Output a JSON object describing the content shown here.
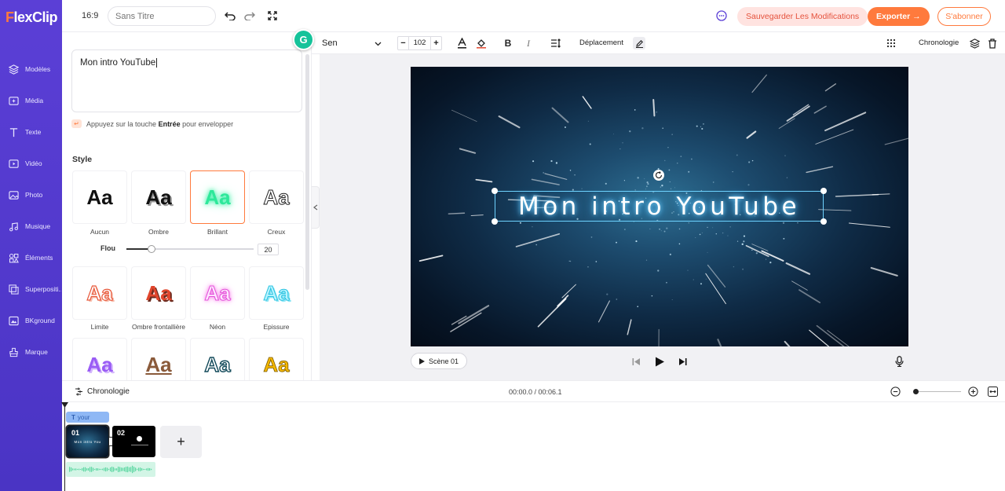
{
  "app": {
    "logo_f": "F",
    "logo_rest": "lexClip"
  },
  "sidebar": {
    "items": [
      {
        "label": "Modèles",
        "icon": "layers-icon"
      },
      {
        "label": "Média",
        "icon": "media-icon"
      },
      {
        "label": "Texte",
        "icon": "text-icon"
      },
      {
        "label": "Vidéo",
        "icon": "video-icon"
      },
      {
        "label": "Photo",
        "icon": "photo-icon"
      },
      {
        "label": "Musique",
        "icon": "music-icon"
      },
      {
        "label": "Éléments",
        "icon": "elements-icon"
      },
      {
        "label": "Superpositi...",
        "icon": "overlay-icon"
      },
      {
        "label": "BKground",
        "icon": "background-icon"
      },
      {
        "label": "Marque",
        "icon": "brand-icon"
      }
    ]
  },
  "topbar": {
    "ratio": "16:9",
    "title_placeholder": "Sans Titre",
    "save_label": "Sauvegarder Les Modifications",
    "export_label": "Exporter →",
    "subscribe_label": "S'abonner"
  },
  "editor": {
    "text_value": "Mon intro YouTube",
    "hint_prefix": "Appuyez sur la touche ",
    "hint_key": "Entrée",
    "hint_suffix": " pour envelopper",
    "style_title": "Style",
    "flou_label": "Flou",
    "flou_value": "20",
    "flou_fraction": 0.2,
    "styles": [
      {
        "label": "Aucun",
        "selected": false
      },
      {
        "label": "Ombre",
        "selected": false
      },
      {
        "label": "Brillant",
        "selected": true
      },
      {
        "label": "Creux",
        "selected": false
      },
      {
        "label": "Limite",
        "selected": false
      },
      {
        "label": "Ombre frontallière",
        "selected": false
      },
      {
        "label": "Néon",
        "selected": false
      },
      {
        "label": "Epissure",
        "selected": false
      }
    ],
    "style_sample": "Aa"
  },
  "format_toolbar": {
    "font": "Sen",
    "font_size": "102",
    "minus": "−",
    "plus": "+",
    "move_label": "Déplacement",
    "timeline_label": "Chronologie"
  },
  "canvas": {
    "title_text": "Mon intro YouTube",
    "scene_label": "Scène 01"
  },
  "timeline": {
    "label": "Chronologie",
    "time": "00:00.0 / 00:06.1",
    "text_track_label": "your",
    "clips": [
      {
        "num": "01",
        "caption": "Mon intro You"
      },
      {
        "num": "02",
        "caption": ""
      }
    ],
    "add_label": "+"
  },
  "colors": {
    "accent": "#ff7a3d",
    "sidebar": "#4a34c4",
    "glow": "#7fd8ff"
  }
}
